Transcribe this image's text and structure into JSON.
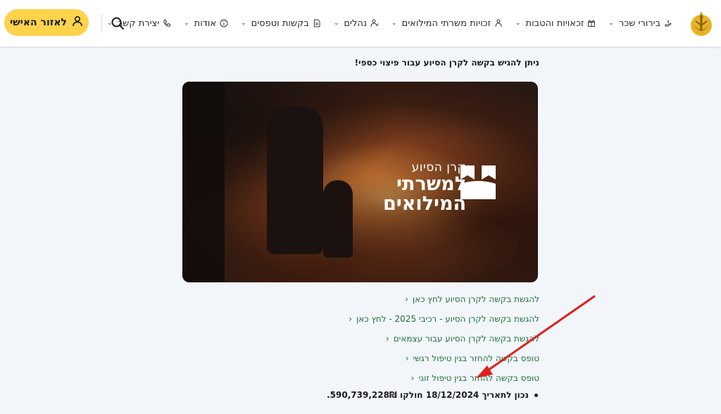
{
  "nav": {
    "items": [
      {
        "label": "בירורי שכר",
        "icon": "money-hand-icon"
      },
      {
        "label": "זכאויות והטבות",
        "icon": "gift-icon"
      },
      {
        "label": "זכויות משרתי המילואים",
        "icon": "soldiers-icon"
      },
      {
        "label": "נהלים",
        "icon": "person-procedures-icon"
      },
      {
        "label": "בקשות וטפסים",
        "icon": "document-icon"
      },
      {
        "label": "אודות",
        "icon": "info-icon"
      },
      {
        "label": "יצירת קשר",
        "icon": "phone-icon"
      }
    ],
    "personal_area": "לאזור האישי"
  },
  "content": {
    "intro": "ניתן להגיש בקשה לקרן הסיוע עבור פיצוי כספי!",
    "hero": {
      "line1": "קרן הסיוע",
      "line2": "למשרתי",
      "line3": "המילואים"
    },
    "links": [
      "להגשת בקשה לקרן הסיוע לחץ כאן",
      "להגשת בקשה לקרן הסיוע - רכיבי 2025 - לחץ כאן",
      "להגשת בקשה לקרן הסיוע עבור עצמאים",
      "טופס בקשה להחזר בגין טיפול רגשי",
      "טופס בקשה להחזר בגין טיפול זוגי"
    ],
    "bullet": "נכון לתאריך 18/12/2024 חולקו 590,739,228₪."
  },
  "colors": {
    "accent_yellow": "#fcd34a",
    "link_green": "#1f6f3a",
    "annotation_red": "#e0201b",
    "page_bg": "#f2f6fb"
  }
}
